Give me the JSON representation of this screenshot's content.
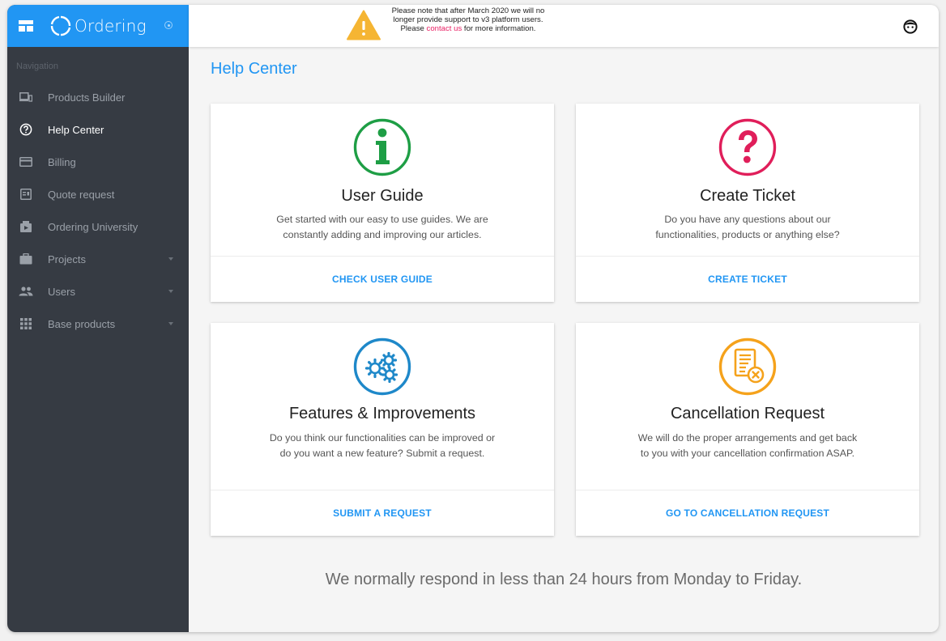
{
  "brand": {
    "name": "Ordering"
  },
  "notice": {
    "text_before": "Please note that after March 2020 we will no longer provide support to v3 platform users. Please ",
    "link_text": "contact us",
    "text_after": " for more information."
  },
  "sidebar": {
    "heading": "Navigation",
    "items": [
      {
        "label": "Products Builder",
        "icon": "devices-icon"
      },
      {
        "label": "Help Center",
        "icon": "help-circle-icon",
        "active": true
      },
      {
        "label": "Billing",
        "icon": "credit-card-icon"
      },
      {
        "label": "Quote request",
        "icon": "quote-doc-icon"
      },
      {
        "label": "Ordering University",
        "icon": "university-icon"
      },
      {
        "label": "Projects",
        "icon": "briefcase-icon",
        "has_submenu": true
      },
      {
        "label": "Users",
        "icon": "people-icon",
        "has_submenu": true
      },
      {
        "label": "Base products",
        "icon": "grid-icon",
        "has_submenu": true
      }
    ]
  },
  "main": {
    "title": "Help Center",
    "cards": [
      {
        "title": "User Guide",
        "description": "Get started with our easy to use guides. We are constantly adding and improving our articles.",
        "action": "CHECK USER GUIDE",
        "icon": "info-icon",
        "color": "#1e9e45"
      },
      {
        "title": "Create Ticket",
        "description": "Do you have any questions about our functionalities, products or anything else?",
        "action": "CREATE TICKET",
        "icon": "question-icon",
        "color": "#e01e5a"
      },
      {
        "title": "Features & Improvements",
        "description": "Do you think our functionalities can be improved or do you want a new feature? Submit a request.",
        "action": "SUBMIT A REQUEST",
        "icon": "gears-icon",
        "color": "#1e88c9"
      },
      {
        "title": "Cancellation Request",
        "description": "We will do the proper arrangements and get back to you with your cancellation confirmation ASAP.",
        "action": "GO TO CANCELLATION REQUEST",
        "icon": "cancel-document-icon",
        "color": "#f5a21b"
      }
    ],
    "footer_note": "We normally respond in less than 24 hours from Monday to Friday."
  },
  "colors": {
    "accent": "#2196f3",
    "sidebar": "#363b43",
    "link": "#e91e63",
    "warning": "#f5b533"
  }
}
